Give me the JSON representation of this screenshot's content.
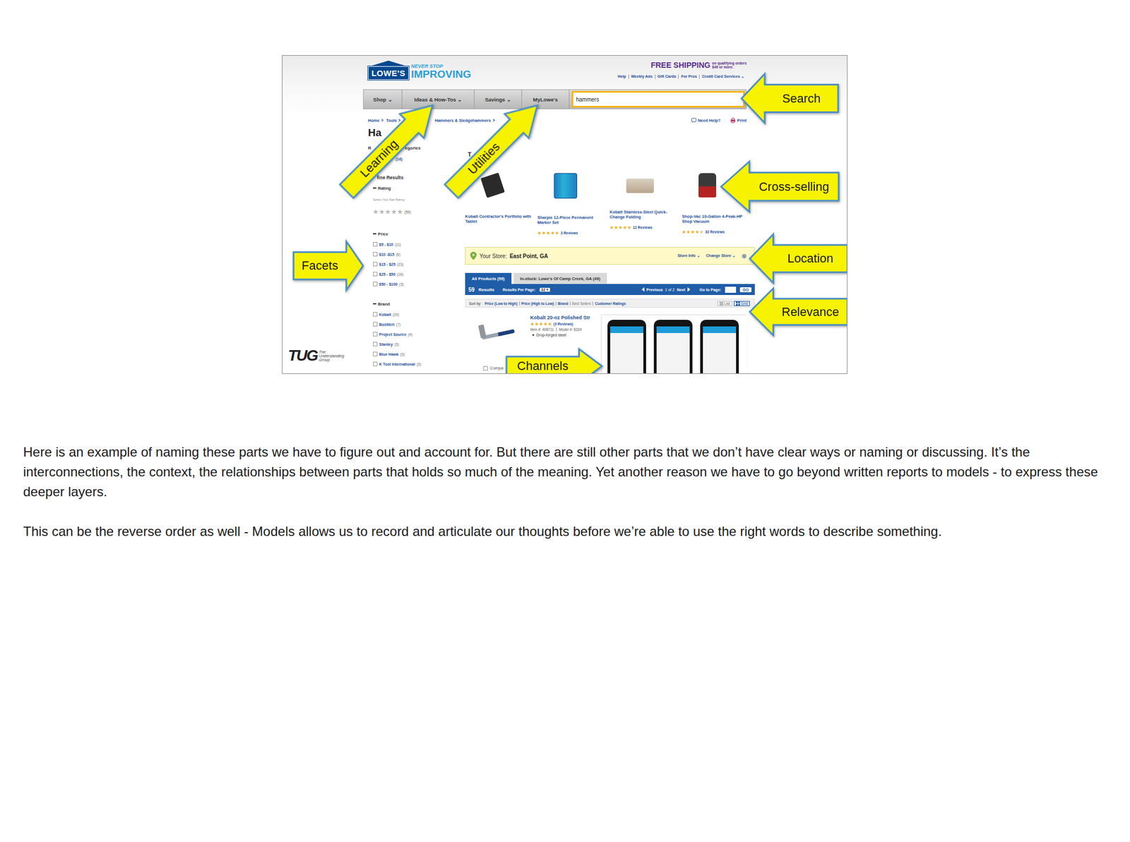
{
  "screenshot": {
    "header": {
      "logo": "LOWE'S",
      "tagline_top": "NEVER STOP",
      "tagline": "IMPROVING",
      "shipping": "FREE SHIPPING",
      "shipping_note": [
        "on qualifying orders",
        "$49 or more."
      ],
      "links": [
        "Help",
        "Weekly Ads",
        "Gift Cards",
        "For Pros",
        "Credit Card Services ⌄"
      ]
    },
    "nav": [
      {
        "label": "Shop ⌄"
      },
      {
        "label": "Ideas & How-Tos ⌄"
      },
      {
        "label": "Savings ⌄"
      },
      {
        "label": "MyLowe's"
      }
    ],
    "search": {
      "value": "hammers"
    },
    "breadcrumb": [
      "Home",
      "Tools",
      "Hammers & Sledgehammers"
    ],
    "utilities": [
      "Need Help?",
      "Print"
    ],
    "sidebar": {
      "title": "Ha",
      "categories_parts": [
        "R",
        "egories"
      ],
      "categories_count": "(16)",
      "refine_label": "fine Results",
      "rating": {
        "label": "Rating",
        "hint": "Select Your Star Rating",
        "stars": 0,
        "count": "(59)"
      },
      "groups": [
        {
          "label": "Price",
          "items": [
            {
              "label": "$5 - $10",
              "count": "(11)",
              "checked": false
            },
            {
              "label": "$10 -$15",
              "count": "(6)",
              "checked": false
            },
            {
              "label": "$15 - $25",
              "count": "(23)",
              "checked": false
            },
            {
              "label": "$25 - $50",
              "count": "(16)",
              "checked": false
            },
            {
              "label": "$50 - $100",
              "count": "(3)",
              "checked": false
            }
          ]
        },
        {
          "label": "Brand",
          "items": [
            {
              "label": "Kobalt",
              "count": "(29)",
              "checked": false
            },
            {
              "label": "Bostitch",
              "count": "(7)",
              "checked": false
            },
            {
              "label": "Project Source",
              "count": "(4)",
              "checked": false
            },
            {
              "label": "Stanley",
              "count": "(3)",
              "checked": false
            },
            {
              "label": "Blue Hawk",
              "count": "(3)",
              "checked": false
            },
            {
              "label": "K Tool International",
              "count": "(3)",
              "checked": false
            }
          ]
        }
      ]
    },
    "section_title": "T",
    "products": [
      {
        "name": "Kobalt Contractor's Portfolio with Tablet"
      },
      {
        "name": "Sharpie 12-Piece Permanent Marker Set",
        "stars": 5,
        "reviews": "3 Reviews"
      },
      {
        "name": "Kobalt Stainless-Steel Quick-Change Folding",
        "stars": 5,
        "reviews": "12 Reviews"
      },
      {
        "name": "Shop-Vac 10-Gallon 4-Peak-HP Shop Vacuum",
        "stars": 4.5,
        "reviews": "33 Reviews"
      }
    ],
    "store": {
      "label": "Your Store:",
      "name": "East Point, GA",
      "links": [
        "Store Info ⌄",
        "Change Store ⌄"
      ],
      "close": "⊗"
    },
    "tabs": [
      {
        "label": "All Products (59)",
        "selected": true
      },
      {
        "label": "In-stock: Lowe's Of Camp Creek, GA (49)",
        "selected": false
      }
    ],
    "results": {
      "count": "59",
      "label": "Results",
      "per_page_label": "Results Per Page:",
      "per_page": "32",
      "previous": "Previous",
      "page": "1 of 2",
      "next": "Next",
      "goto_label": "Go to Page:",
      "goto_button": "GO"
    },
    "sort": {
      "label": "Sort by:",
      "options": [
        {
          "label": "Price (Low to High)",
          "selected": false
        },
        {
          "label": "Price (High to Low)",
          "selected": false
        },
        {
          "label": "Brand",
          "selected": false
        },
        {
          "label": "Best Sellers",
          "selected": true
        },
        {
          "label": "Customer Ratings",
          "selected": false
        }
      ],
      "views": [
        {
          "label": "List",
          "selected": false
        },
        {
          "label": "Grid",
          "selected": true
        }
      ]
    },
    "listing": {
      "name": "Kobalt 20-oz Polished Str",
      "stars": 5,
      "reviews": "(3 Reviews)",
      "item": "Item #: 498711",
      "model": "Model #: 8339",
      "bullets": [
        "Drop-forged steel"
      ],
      "compare": "Compa",
      "compare_checked": false
    },
    "watermark": {
      "logo": "TUG",
      "lines": [
        "The",
        "Understanding",
        "Group"
      ]
    }
  },
  "callouts": [
    {
      "label": "Search",
      "kind": "left"
    },
    {
      "label": "Learning",
      "kind": "up-right"
    },
    {
      "label": "Utilities",
      "kind": "up-right"
    },
    {
      "label": "Cross-selling",
      "kind": "left"
    },
    {
      "label": "Facets",
      "kind": "right"
    },
    {
      "label": "Location",
      "kind": "left"
    },
    {
      "label": "Relevance",
      "kind": "left"
    },
    {
      "label": "Channels",
      "kind": "right"
    }
  ],
  "notes": [
    "Here is an example of naming these parts we have to figure out and account for. But there are still other parts that we don’t have clear ways or naming or discussing. It’s the interconnections, the context, the relationships between parts that holds so much of the meaning. Yet another reason we have to go beyond written reports to models - to express these deeper layers.",
    "This can be the reverse order as well - Models allows us to record and articulate our thoughts before we’re able to use the right words to describe something."
  ]
}
